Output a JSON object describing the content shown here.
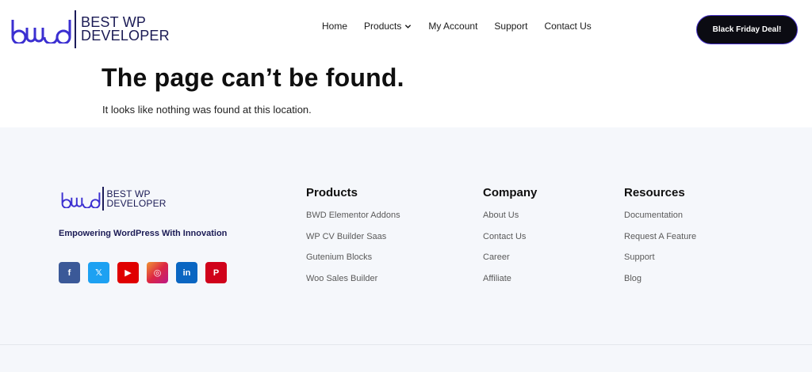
{
  "brand": {
    "logo_mark": "bwd",
    "name_line1": "BEST WP",
    "name_line2": "DEVELOPER",
    "color": "#3b2fd1"
  },
  "nav": {
    "items": [
      {
        "label": "Home"
      },
      {
        "label": "Products",
        "has_dropdown": true
      },
      {
        "label": "My Account"
      },
      {
        "label": "Support"
      },
      {
        "label": "Contact Us"
      }
    ],
    "cta_label": "Black Friday Deal!"
  },
  "hero": {
    "title": "The page can’t be found.",
    "subtitle": "It looks like nothing was found at this location."
  },
  "footer": {
    "tagline": "Empowering WordPress With Innovation",
    "socials": [
      {
        "icon": "facebook-icon",
        "glyph": "f",
        "color": "#3b5998"
      },
      {
        "icon": "x-twitter-icon",
        "glyph": "𝕏",
        "color": "#1da1f2"
      },
      {
        "icon": "youtube-icon",
        "glyph": "▶",
        "color": "#e00000"
      },
      {
        "icon": "instagram-icon",
        "glyph": "◎",
        "color": "#d6427a"
      },
      {
        "icon": "linkedin-icon",
        "glyph": "in",
        "color": "#0a66c2"
      },
      {
        "icon": "pinterest-icon",
        "glyph": "P",
        "color": "#d0021b"
      }
    ],
    "columns": [
      {
        "title": "Products",
        "links": [
          "BWD Elementor Addons",
          "WP CV Builder Saas",
          "Gutenium Blocks",
          "Woo Sales Builder"
        ]
      },
      {
        "title": "Company",
        "links": [
          "About Us",
          "Contact Us",
          "Career",
          "Affiliate"
        ]
      },
      {
        "title": "Resources",
        "links": [
          "Documentation",
          "Request A Feature",
          "Support",
          "Blog"
        ]
      }
    ]
  }
}
